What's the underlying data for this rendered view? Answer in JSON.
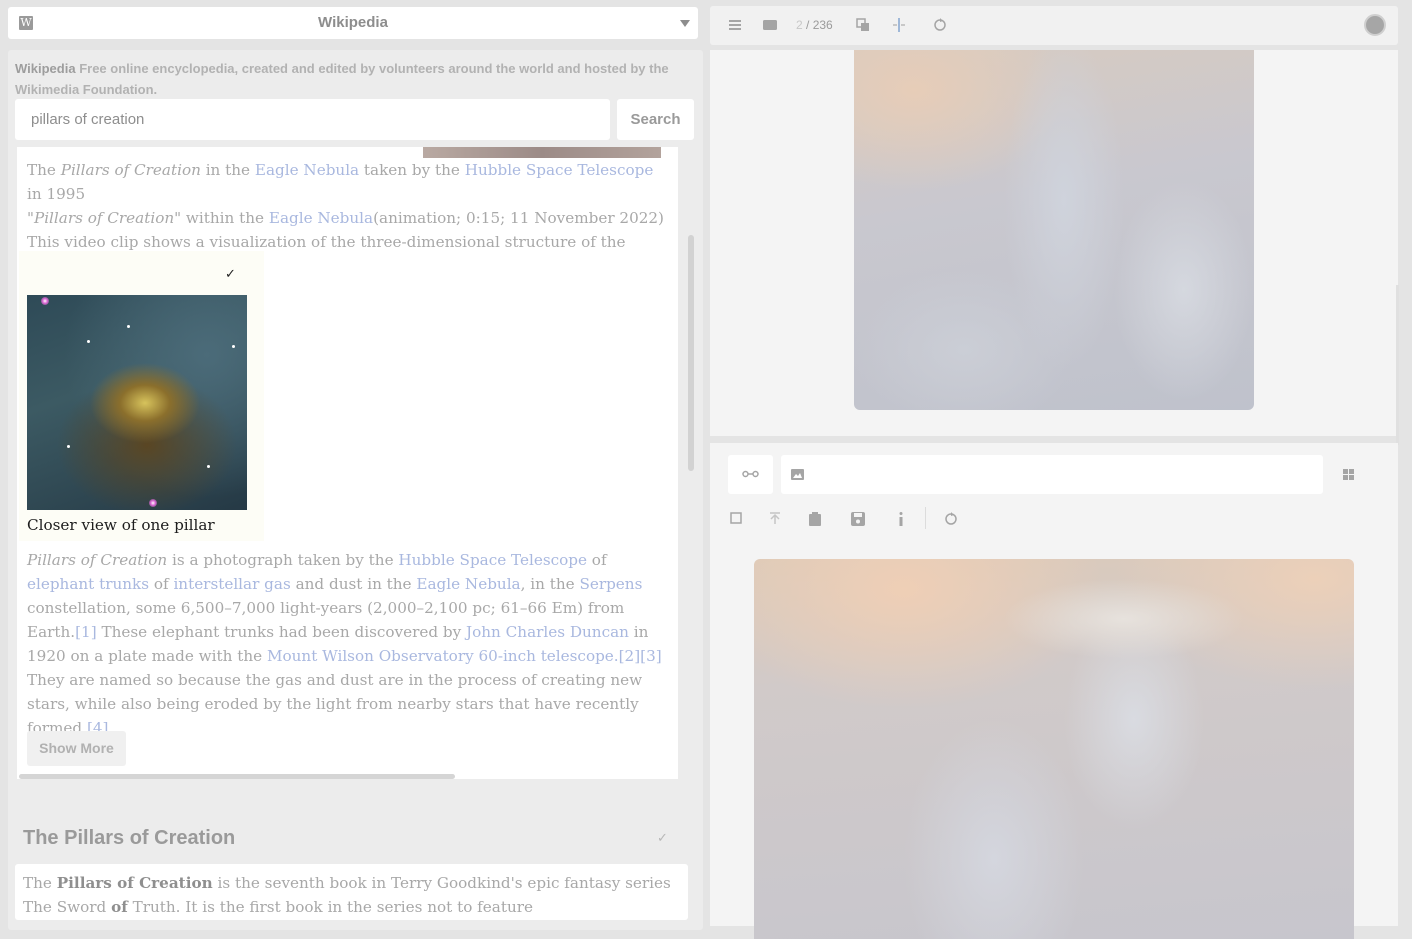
{
  "source_selector": {
    "logo_letter": "W",
    "title": "Wikipedia"
  },
  "site": {
    "name": "Wikipedia",
    "description": "Free online encyclopedia, created and edited by volunteers around the world and hosted by the Wikimedia Foundation."
  },
  "search": {
    "value": "pillars of creation",
    "button_label": "Search"
  },
  "result1": {
    "caption": {
      "t1": "The ",
      "i1": "Pillars of Creation",
      "t2": " in the ",
      "l1": "Eagle Nebula",
      "t3": " taken by the ",
      "l2": "Hubble Space Telescope",
      "t4": " in 1995 ",
      "i2": "\"Pillars of Creation\"",
      "t5": " within the ",
      "l3": "Eagle Nebula",
      "t6": "(animation; 0:15; 11 November 2022) This video clip shows a visualization of the three-dimensional structure of the Pillars of Creation."
    },
    "figure_check": "✓",
    "figure_caption": "Closer view of one pillar",
    "summary": {
      "i1": "Pillars of Creation",
      "t1": " is a photograph taken by the ",
      "l1": "Hubble Space Telescope",
      "t2": " of ",
      "l2": "elephant trunks",
      "t3": " of ",
      "l3": "interstellar gas",
      "t4": " and dust in the ",
      "l4": "Eagle Nebula",
      "t5": ", in the ",
      "l5": "Serpens",
      "t6": " constellation, some 6,500–7,000 light-years (2,000–2,100 pc; 61–66 Em) from Earth.",
      "r1": "[1]",
      "t7": " These elephant trunks had been discovered by ",
      "l6": "John Charles Duncan",
      "t8": " in 1920 on a plate made with the ",
      "l7": "Mount Wilson Observatory 60-inch telescope.",
      "r2": "[2]",
      "r3": "[3]",
      "t9": " They are named so because the gas and dust are in the process of creating new stars, while also being eroded by the light from nearby stars that have recently formed.",
      "r4": "[4]"
    },
    "show_more_label": "Show More"
  },
  "result2": {
    "title": "The Pillars of Creation",
    "check": "✓",
    "t1": "The ",
    "b1": "Pillars of Creation",
    "t2": " is the seventh book in Terry Goodkind's epic fantasy series The Sword ",
    "b2": "of",
    "t3": " Truth. It is the first book in the series not to feature"
  },
  "viewer": {
    "page_current": "2",
    "page_total": "/ 236",
    "icons": [
      "menu-icon",
      "folder-icon",
      "copy-icon",
      "split-icon",
      "recycle-icon",
      "avatar"
    ]
  },
  "editor": {
    "link_icon": "link-icon",
    "image_field_icon": "image-icon",
    "image_field_value": "",
    "toolbar_icons": [
      "checkbox-icon",
      "upload-icon",
      "clipboard-icon",
      "save-icon",
      "info-icon",
      "recycle-icon"
    ]
  }
}
